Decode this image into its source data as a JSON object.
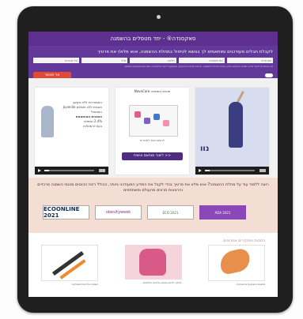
{
  "page": {
    "header_title": "סאקסנדה® - יחד מטפלים בהשמנה"
  },
  "form": {
    "title": "לקבלת חבלים מעודכנים ומותאמים לך בנושא לטיפול במחלת ההשמנה, אנא מלא/י את פרטיך",
    "fields": [
      {
        "placeholder": "שם פרטי"
      },
      {
        "placeholder": "שם משפחה"
      },
      {
        "placeholder": "טלפון"
      },
      {
        "placeholder": "מייל"
      },
      {
        "placeholder": "עיר מגורים"
      }
    ],
    "legal_text": "אני מאשר/ת לקבל מידע ותכנים שיווקיים ומידע אודות מחלת ההשמנה, תכניות תמיכה ואירועים, באמצעות דואר אלקטרוני, מסרונים ואמצעים נוספים.",
    "submit_label": "אני מאשר"
  },
  "banners": {
    "right": {
      "logo_text": "נוו"
    },
    "middle": {
      "title": "תכנית התמיכה NovoCare",
      "subtitle": "להצטרפות לתוכנית",
      "cta_label": "ליצור מותאם אישית >>"
    },
    "left": {
      "line1": "התמודדות ללא מעקב",
      "line2": "תוכנית ללא תשלום Juvenile",
      "line3": "המטופל",
      "line4": "התכנית המותאמת",
      "line5": "2.4% נוספים",
      "line6": "בעזרת שאלות"
    }
  },
  "promo": {
    "text": "רוצה ללמוד עוד על מחלת ההשמנה? אנא מלא את פרטיך בכדי לקבל את המידע המעודכני ביותר, הכולל ריכוז הכנסים מכנסי השמנה מרכזיים והרצאות מרצים מהעולם ומשתתפים"
  },
  "logos": [
    "ECOONLINE 2021",
    "obesityweek",
    "ECO 2021",
    "ADA 2021"
  ],
  "articles": {
    "title": "כתבות ומחקרים אחרונים",
    "items": [
      {
        "caption": "השמנה ותרופות משולבות"
      },
      {
        "caption": "מחקר חדשני בנושא תרופות וחלבונים"
      },
      {
        "caption": "סיכונים והשפעות בריאותיות"
      }
    ]
  }
}
